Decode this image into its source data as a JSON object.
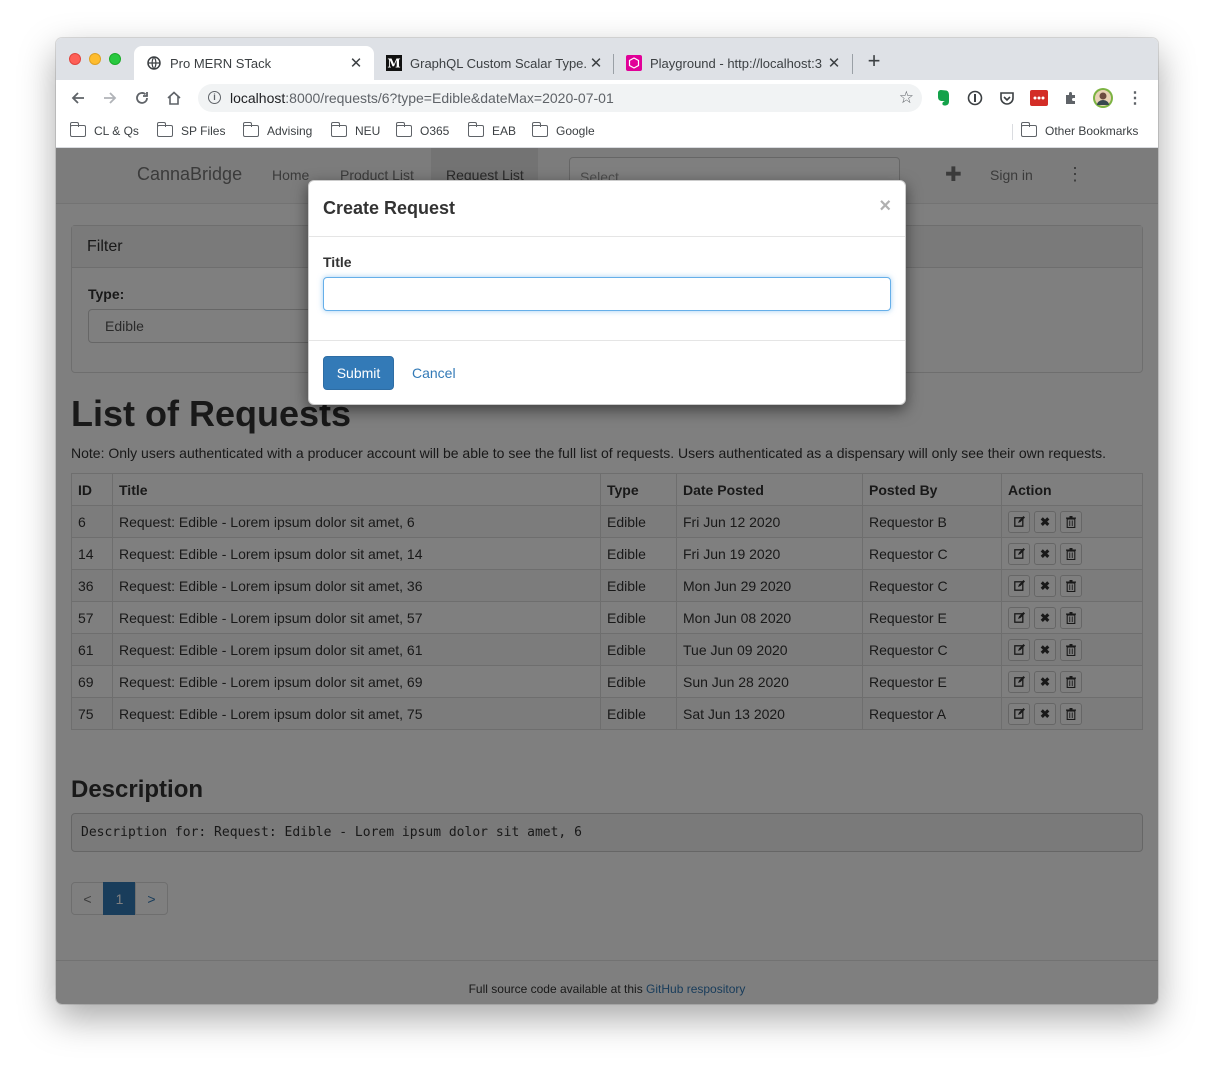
{
  "browser": {
    "tabs": [
      {
        "label": "Pro MERN STack",
        "active": true
      },
      {
        "label": "GraphQL Custom Scalar Type.",
        "active": false
      },
      {
        "label": "Playground - http://localhost:3",
        "active": false
      }
    ],
    "url_host": "localhost",
    "url_rest": ":8000/requests/6?type=Edible&dateMax=2020-07-01",
    "bookmarks": [
      "CL & Qs",
      "SP Files",
      "Advising",
      "NEU",
      "O365",
      "EAB",
      "Google"
    ],
    "other_bookmarks": "Other Bookmarks"
  },
  "navbar": {
    "brand": "CannaBridge",
    "links": [
      "Home",
      "Product List",
      "Request List"
    ],
    "select_placeholder": "Select...",
    "signin": "Sign in"
  },
  "filter": {
    "heading": "Filter",
    "type_label": "Type:",
    "type_value": "Edible"
  },
  "list": {
    "heading": "List of Requests",
    "note": "Note: Only users authenticated with a producer account will be able to see the full list of requests. Users authenticated as a dispensary will only see their own requests.",
    "columns": [
      "ID",
      "Title",
      "Type",
      "Date Posted",
      "Posted By",
      "Action"
    ],
    "rows": [
      [
        "6",
        "Request: Edible - Lorem ipsum dolor sit amet, 6",
        "Edible",
        "Fri Jun 12 2020",
        "Requestor B"
      ],
      [
        "14",
        "Request: Edible - Lorem ipsum dolor sit amet, 14",
        "Edible",
        "Fri Jun 19 2020",
        "Requestor C"
      ],
      [
        "36",
        "Request: Edible - Lorem ipsum dolor sit amet, 36",
        "Edible",
        "Mon Jun 29 2020",
        "Requestor C"
      ],
      [
        "57",
        "Request: Edible - Lorem ipsum dolor sit amet, 57",
        "Edible",
        "Mon Jun 08 2020",
        "Requestor E"
      ],
      [
        "61",
        "Request: Edible - Lorem ipsum dolor sit amet, 61",
        "Edible",
        "Tue Jun 09 2020",
        "Requestor C"
      ],
      [
        "69",
        "Request: Edible - Lorem ipsum dolor sit amet, 69",
        "Edible",
        "Sun Jun 28 2020",
        "Requestor E"
      ],
      [
        "75",
        "Request: Edible - Lorem ipsum dolor sit amet, 75",
        "Edible",
        "Sat Jun 13 2020",
        "Requestor A"
      ]
    ]
  },
  "description": {
    "heading": "Description",
    "text": "Description for: Request: Edible - Lorem ipsum dolor sit amet, 6"
  },
  "pagination": {
    "prev": "<",
    "current": "1",
    "next": ">"
  },
  "footer": {
    "text": "Full source code available at this ",
    "link": "GitHub respository"
  },
  "modal": {
    "title": "Create Request",
    "close": "×",
    "field_label": "Title",
    "field_value": "",
    "submit": "Submit",
    "cancel": "Cancel"
  },
  "colors": {
    "primary": "#337ab7",
    "backdrop": "rgba(0,0,0,0.5)"
  }
}
